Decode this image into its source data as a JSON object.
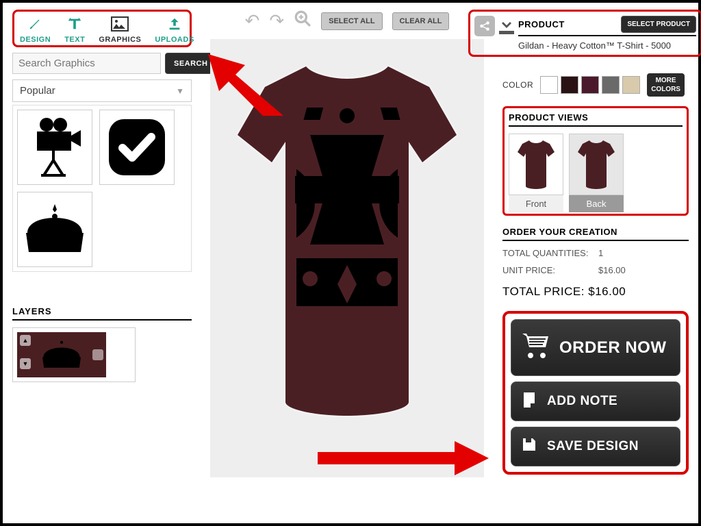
{
  "tools": {
    "design": "DESIGN",
    "text": "TEXT",
    "graphics": "GRAPHICS",
    "uploads": "UPLOADS"
  },
  "search": {
    "placeholder": "Search Graphics",
    "button": "SEARCH"
  },
  "filter": {
    "selected": "Popular"
  },
  "top_controls": {
    "select_all": "SELECT ALL",
    "clear_all": "CLEAR ALL"
  },
  "product": {
    "label": "PRODUCT",
    "select_button": "SELECT PRODUCT",
    "name": "Gildan - Heavy Cotton™ T-Shirt - 5000"
  },
  "color": {
    "label": "COLOR",
    "swatches": [
      "#ffffff",
      "#2a1214",
      "#4a1a2c",
      "#6a6a6a",
      "#d8caab"
    ],
    "more": "MORE COLORS"
  },
  "views": {
    "title": "PRODUCT VIEWS",
    "front": "Front",
    "back": "Back"
  },
  "order": {
    "title": "ORDER YOUR CREATION",
    "qty_label": "TOTAL QUANTITIES:",
    "qty_value": "1",
    "unit_label": "UNIT PRICE:",
    "unit_value": "$16.00",
    "total_label": "TOTAL PRICE:",
    "total_value": "$16.00"
  },
  "cta": {
    "order_now": "ORDER NOW",
    "add_note": "ADD NOTE",
    "save_design": "SAVE DESIGN"
  },
  "layers": {
    "title": "LAYERS"
  }
}
